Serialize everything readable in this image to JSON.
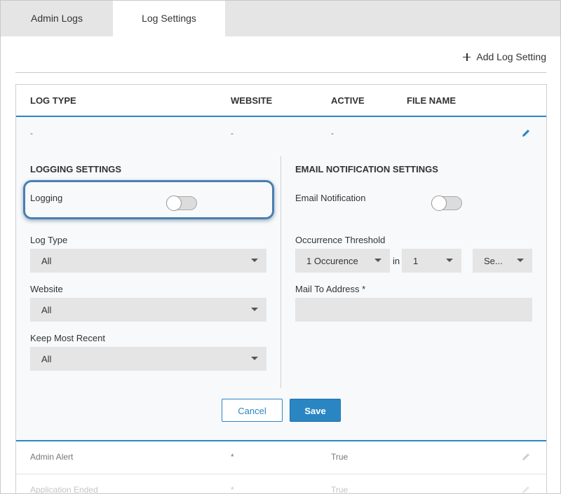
{
  "tabs": [
    {
      "label": "Admin Logs",
      "active": false
    },
    {
      "label": "Log Settings",
      "active": true
    }
  ],
  "actions": {
    "add_log_setting": "Add Log Setting"
  },
  "table": {
    "headers": {
      "log_type": "LOG TYPE",
      "website": "WEBSITE",
      "active": "ACTIVE",
      "file_name": "FILE NAME"
    },
    "expanded_row": {
      "log_type": "-",
      "website": "-",
      "active": "-"
    },
    "rows": [
      {
        "log_type": "Admin Alert",
        "website": "*",
        "active": "True"
      },
      {
        "log_type": "Application Ended",
        "website": "*",
        "active": "True"
      }
    ]
  },
  "logging_settings": {
    "title": "LOGGING SETTINGS",
    "logging_label": "Logging",
    "logging_enabled": false,
    "log_type_label": "Log Type",
    "log_type_value": "All",
    "website_label": "Website",
    "website_value": "All",
    "keep_most_recent_label": "Keep Most Recent",
    "keep_most_recent_value": "All"
  },
  "email_settings": {
    "title": "EMAIL NOTIFICATION SETTINGS",
    "email_notification_label": "Email Notification",
    "email_notification_enabled": false,
    "threshold_label": "Occurrence Threshold",
    "threshold_count_value": "1 Occurence",
    "in_label": "in",
    "threshold_number_value": "1",
    "threshold_unit_value": "Se...",
    "mail_to_label": "Mail To Address *",
    "mail_to_value": ""
  },
  "buttons": {
    "cancel": "Cancel",
    "save": "Save"
  },
  "colors": {
    "accent": "#2a86c3",
    "tab_bar": "#e5e5e5",
    "field": "#e5e5e5",
    "highlight": "#4a7fb0"
  }
}
